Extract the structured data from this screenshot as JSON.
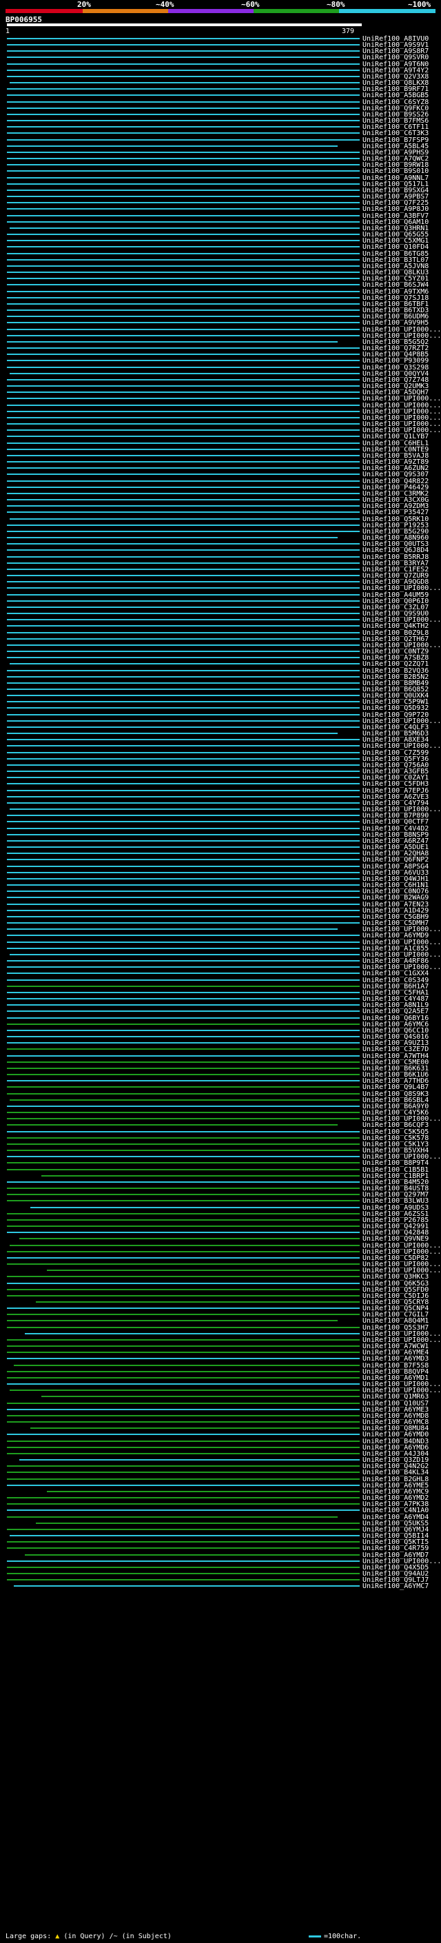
{
  "header": {
    "percent_labels": [
      "20%",
      "~40%",
      "~60%",
      "~80%",
      "~100%"
    ],
    "color_scale": [
      "#d4001a",
      "#e07a12",
      "#8a2be2",
      "#1e9e1e",
      "#2ec8e0"
    ],
    "query_id": "BP006955",
    "query_start": "1",
    "query_end": "379"
  },
  "hits": [
    "UniRef100_A8IVU0",
    "UniRef100_A9S9V1",
    "UniRef100_A9S8R7",
    "UniRef100_Q9SVR0",
    "UniRef100_A9T6N0",
    "UniRef100_A9T4Y2",
    "UniRef100_Q2V3X8",
    "UniRef100_Q8LKX8",
    "UniRef100_B9RF71",
    "UniRef100_A5BGB5",
    "UniRef100_C6SYZ8",
    "UniRef100_Q9FKC0",
    "UniRef100_B9SS26",
    "UniRef100_B7FMS6",
    "UniRef100_C6TF11",
    "UniRef100_C6T3K3",
    "UniRef100_B7FSP9",
    "UniRef100_A5BL45",
    "UniRef100_A9PHS9",
    "UniRef100_A7QWC2",
    "UniRef100_B9RW18",
    "UniRef100_B9S010",
    "UniRef100_A9NNL7",
    "UniRef100_Q517L1",
    "UniRef100_B9SXG4",
    "UniRef100_A9PBS7",
    "UniRef100_Q7F225",
    "UniRef100_A9P8J0",
    "UniRef100_A3BFV7",
    "UniRef100_Q6AM10",
    "UniRef100_Q3HRN1",
    "UniRef100_Q65G55",
    "UniRef100_C5XMG1",
    "UniRef100_Q10FD4",
    "UniRef100_B6TG85",
    "UniRef100_B3TL07",
    "UniRef100_A5JVN8",
    "UniRef100_Q8LKU3",
    "UniRef100_C5YZ01",
    "UniRef100_B6SJW4",
    "UniRef100_A9TXM6",
    "UniRef100_Q7SJ18",
    "UniRef100_B6TBF1",
    "UniRef100_B6TXD3",
    "UniRef100_B6UDM6",
    "UniRef100_A9V9H5",
    "UniRef100_UPI000...",
    "UniRef100_UPI000...",
    "UniRef100_B5G5Q2",
    "UniRef100_Q7RZT2",
    "UniRef100_Q4P8B5",
    "UniRef100_P93099",
    "UniRef100_Q3S298",
    "UniRef100_Q0QYV4",
    "UniRef100_Q7Z748",
    "UniRef100_Q2UMK3",
    "UniRef100_A5DQH7",
    "UniRef100_UPI000...",
    "UniRef100_UPI000...",
    "UniRef100_UPI000...",
    "UniRef100_UPI000...",
    "UniRef100_UPI000...",
    "UniRef100_UPI000...",
    "UniRef100_Q1LYB7",
    "UniRef100_C6HEL1",
    "UniRef100_C0NTE9",
    "UniRef100_B5VAJ8",
    "UniRef100_A9ZT89",
    "UniRef100_A6ZUN2",
    "UniRef100_Q9S307",
    "UniRef100_Q4R822",
    "UniRef100_P46429",
    "UniRef100_C3RMK2",
    "UniRef100_A3CX0G",
    "UniRef100_A9ZDM3",
    "UniRef100_P35427",
    "UniRef100_Q5RK10",
    "UniRef100_P19253",
    "UniRef100_B5G290",
    "UniRef100_A8N960",
    "UniRef100_Q0UTS3",
    "UniRef100_Q6J8D4",
    "UniRef100_B5RRJ8",
    "UniRef100_B3RYA7",
    "UniRef100_C1FES2",
    "UniRef100_Q7ZUR9",
    "UniRef100_A9QGD8",
    "UniRef100_UPI000...",
    "UniRef100_A4UM59",
    "UniRef100_Q0P6I0",
    "UniRef100_C3ZL07",
    "UniRef100_Q9S9U0",
    "UniRef100_UPI000...",
    "UniRef100_Q4KTH2",
    "UniRef100_B0Z9L8",
    "UniRef100_Q2TH67",
    "UniRef100_UPI000...",
    "UniRef100_C0NTZ9",
    "UniRef100_A7SBZ8",
    "UniRef100_Q2ZQ71",
    "UniRef100_B2VQ36",
    "UniRef100_B2B5N2",
    "UniRef100_B8MB49",
    "UniRef100_B6Q852",
    "UniRef100_Q0UXK4",
    "UniRef100_C5P9W1",
    "UniRef100_Q5D932",
    "UniRef100_Q9P720",
    "UniRef100_UPI000...",
    "UniRef100_C4QLF3",
    "UniRef100_B5M6D3",
    "UniRef100_A8XE34",
    "UniRef100_UPI000...",
    "UniRef100_C7Z599",
    "UniRef100_Q5FY36",
    "UniRef100_Q756A0",
    "UniRef100_A3GFB5",
    "UniRef100_C0ZAY1",
    "UniRef100_C5FDH3",
    "UniRef100_A7EPJ6",
    "UniRef100_A6ZVE3",
    "UniRef100_C4Y794",
    "UniRef100_UPI000...",
    "UniRef100_B7P890",
    "UniRef100_Q0CTF7",
    "UniRef100_C4V4D2",
    "UniRef100_B8NSP9",
    "UniRef100_A6RZ47",
    "UniRef100_A5DUE1",
    "UniRef100_A2QHA8",
    "UniRef100_Q6FNP2",
    "UniRef100_A8PSG4",
    "UniRef100_A6VU33",
    "UniRef100_Q4WJH1",
    "UniRef100_C6H1N1",
    "UniRef100_C0NO76",
    "UniRef100_B2WAG9",
    "UniRef100_A7EN23",
    "UniRef100_A1D429",
    "UniRef100_C5GBH9",
    "UniRef100_C5DMH7",
    "UniRef100_UPI000...",
    "UniRef100_A6YMD9",
    "UniRef100_UPI000...",
    "UniRef100_A1C855",
    "UniRef100_UPI000...",
    "UniRef100_A4RF86",
    "UniRef100_UPI000...",
    "UniRef100_C1GXX4",
    "UniRef100_C0S349",
    "UniRef100_B6H1A7",
    "UniRef100_C5FHA1",
    "UniRef100_C4Y487",
    "UniRef100_A8N1L9",
    "UniRef100_Q2A5E7",
    "UniRef100_Q6BY16",
    "UniRef100_A6YMC6",
    "UniRef100_Q6CC10",
    "UniRef100_Q4S016",
    "UniRef100_A9UZ13",
    "UniRef100_C3ZE7D",
    "UniRef100_A7WTH4",
    "UniRef100_C5ME00",
    "UniRef100_B6K631",
    "UniRef100_B6K1U6",
    "UniRef100_A7THD6",
    "UniRef100_Q9L4B7",
    "UniRef100_Q8S9K3",
    "UniRef100_B6SBL4",
    "UniRef100_B6A9Y0",
    "UniRef100_C4Y5K6",
    "UniRef100_UPI000...",
    "UniRef100_B6CQF3",
    "UniRef100_C5K5Q5",
    "UniRef100_C5K578",
    "UniRef100_C5K1Y3",
    "UniRef100_B5VXH4",
    "UniRef100_UPI000...",
    "UniRef100_B8P9T4",
    "UniRef100_C1B5B1",
    "UniRef100_C1BRP1",
    "UniRef100_B4M520",
    "UniRef100_B4UST8",
    "UniRef100_Q297M7",
    "UniRef100_B3LWU3",
    "UniRef100_A9UDS3",
    "UniRef100_A6ZSS1",
    "UniRef100_P26785",
    "UniRef100_Q42991",
    "UniRef100_Q42848",
    "UniRef100_Q9VNE9",
    "UniRef100_UPI000...",
    "UniRef100_UPI000...",
    "UniRef100_C5DP82",
    "UniRef100_UPI000...",
    "UniRef100_UPI000...",
    "UniRef100_Q3HKC3",
    "UniRef100_Q6K5G3",
    "UniRef100_Q5SFD0",
    "UniRef100_C5DIJ6",
    "UniRef100_Q5CRY8",
    "UniRef100_Q5CNP4",
    "UniRef100_C7GIL7",
    "UniRef100_A8Q4M1",
    "UniRef100_Q5S3H7",
    "UniRef100_UPI000...",
    "UniRef100_UPI000...",
    "UniRef100_A7WCW1",
    "UniRef100_A6YME4",
    "UniRef100_A6YMD3",
    "UniRef100_B7F5S8",
    "UniRef100_B8QVP4",
    "UniRef100_A6YMD1",
    "UniRef100_UPI000...",
    "UniRef100_UPI000...",
    "UniRef100_Q1MR63",
    "UniRef100_Q10US7",
    "UniRef100_A6YME3",
    "UniRef100_A6YMD8",
    "UniRef100_A6YMC8",
    "UniRef100_Q8MU84",
    "UniRef100_A6YMD0",
    "UniRef100_B4DND3",
    "UniRef100_A6YMD6",
    "UniRef100_A4J304",
    "UniRef100_Q3ZD19",
    "UniRef100_Q4N2G2",
    "UniRef100_B4KL34",
    "UniRef100_B2GHL8",
    "UniRef100_A6YME5",
    "UniRef100_A6YMC9",
    "UniRef100_A6YMD2",
    "UniRef100_A7PK38",
    "UniRef100_C4N1A0",
    "UniRef100_A6YMD4",
    "UniRef100_Q5UKS5",
    "UniRef100_Q6YMJ4",
    "UniRef100_Q5BI14",
    "UniRef100_Q5KTI5",
    "UniRef100_C4R759",
    "UniRef100_A6YMD7",
    "UniRef100_UPI000...",
    "UniRef100_Q4X5D5",
    "UniRef100_Q94AU2",
    "UniRef100_Q9LTJ7",
    "UniRef100_A6YMC7"
  ],
  "footer": {
    "large_gaps_label": "Large gaps:",
    "in_query_label": "(in Query)",
    "in_subject_label": "/~ (in Subject)",
    "scale_label": "=100char."
  }
}
